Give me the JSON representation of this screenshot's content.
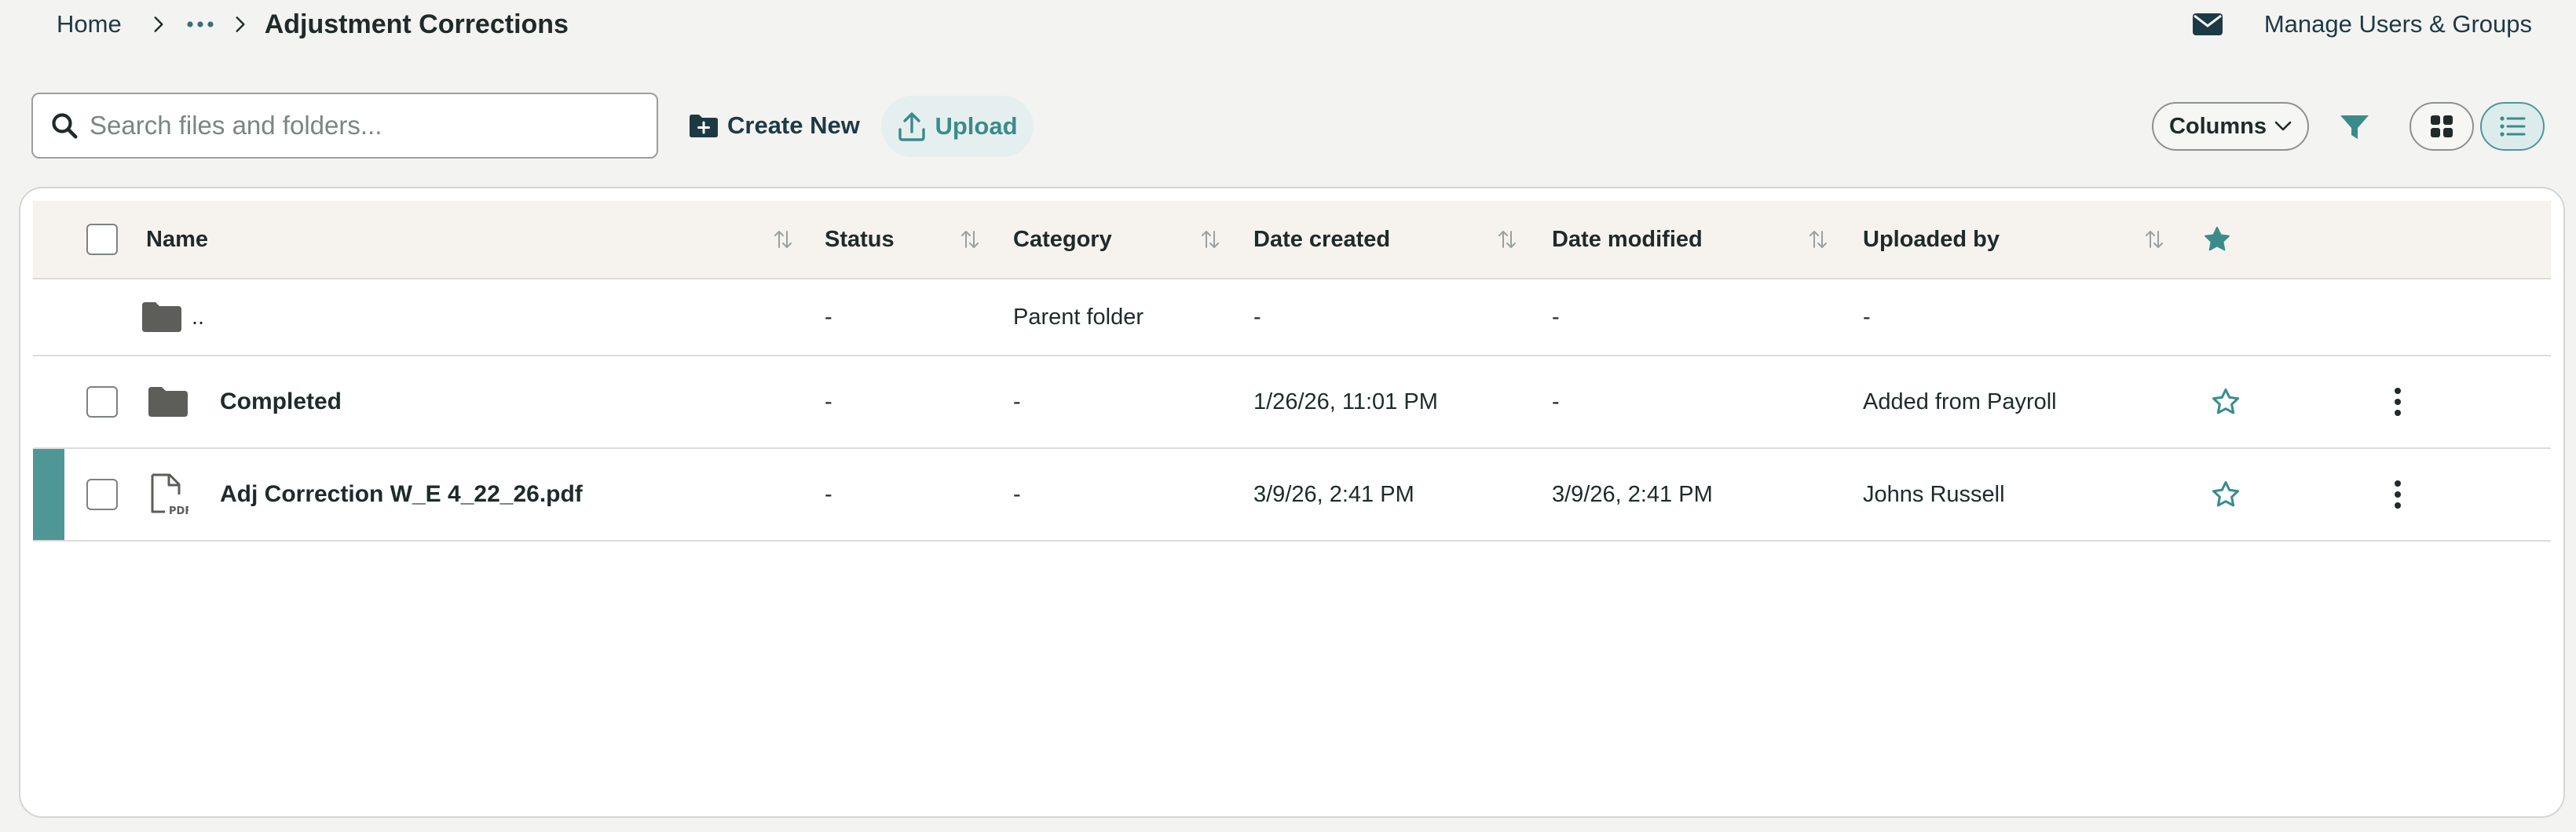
{
  "breadcrumb": {
    "home": "Home",
    "current": "Adjustment Corrections"
  },
  "header": {
    "manage_label": "Manage Users & Groups"
  },
  "toolbar": {
    "search_placeholder": "Search files and folders...",
    "search_value": "",
    "create_label": "Create New",
    "upload_label": "Upload",
    "columns_label": "Columns",
    "view_mode": "list"
  },
  "table": {
    "columns": {
      "name": "Name",
      "status": "Status",
      "category": "Category",
      "date_created": "Date created",
      "date_modified": "Date modified",
      "uploaded_by": "Uploaded by"
    },
    "parent_row": {
      "name": "..",
      "status": "-",
      "category": "Parent folder",
      "date_created": "-",
      "date_modified": "-",
      "uploaded_by": "-"
    },
    "rows": [
      {
        "type": "folder",
        "name": "Completed",
        "status": "-",
        "category": "-",
        "date_created": "1/26/26, 11:01 PM",
        "date_modified": "-",
        "uploaded_by": "Added from Payroll",
        "starred": false,
        "selected": false
      },
      {
        "type": "pdf",
        "name": "Adj Correction W_E 4_22_26.pdf",
        "status": "-",
        "category": "-",
        "date_created": "3/9/26, 2:41 PM",
        "date_modified": "3/9/26, 2:41 PM",
        "uploaded_by": "Johns Russell",
        "starred": false,
        "selected": false,
        "highlighted": true
      }
    ]
  },
  "icons": {
    "breadcrumb_separator": "chevron-right-icon",
    "breadcrumb_more": "ellipsis-icon",
    "mail": "mail-icon",
    "search": "search-icon",
    "create": "folder-plus-icon",
    "upload": "upload-icon",
    "columns_caret": "chevron-down-icon",
    "filter": "filter-icon",
    "grid_view": "grid-icon",
    "list_view": "list-icon",
    "sort": "sort-icon",
    "star_filled": "star-icon",
    "star_outline": "star-outline-icon",
    "folder": "folder-icon",
    "pdf": "pdf-file-icon",
    "more": "kebab-icon"
  },
  "colors": {
    "accent": "#4f9797",
    "brand_dark": "#1d3a44",
    "page_bg": "#f3f3f1",
    "header_row_bg": "#f6f3ee"
  }
}
